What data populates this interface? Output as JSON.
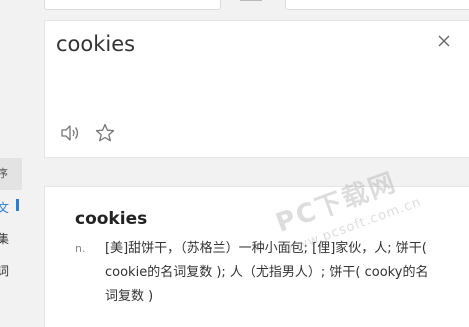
{
  "input": {
    "query": "cookies"
  },
  "sidebar": {
    "tab_label": "序",
    "items": [
      {
        "label": "文",
        "active": true
      },
      {
        "label": "集",
        "active": false
      },
      {
        "label": "词",
        "active": false
      }
    ]
  },
  "result": {
    "headword": "cookies",
    "pos": "n.",
    "definition": "[美]甜饼干，（苏格兰）一种小面包; [俚]家伙，人; 饼干( cookie的名词复数 ); 人（尤指男人）; 饼干( cooky的名词复数 )"
  },
  "watermark": {
    "main": "PC下载网",
    "url": "www.pcsoft.com.cn"
  },
  "colors": {
    "accent": "#2a7ed8",
    "background": "#f2f2f2",
    "panel": "#ffffff"
  },
  "icons": [
    "close-icon",
    "speaker-icon",
    "star-icon"
  ]
}
